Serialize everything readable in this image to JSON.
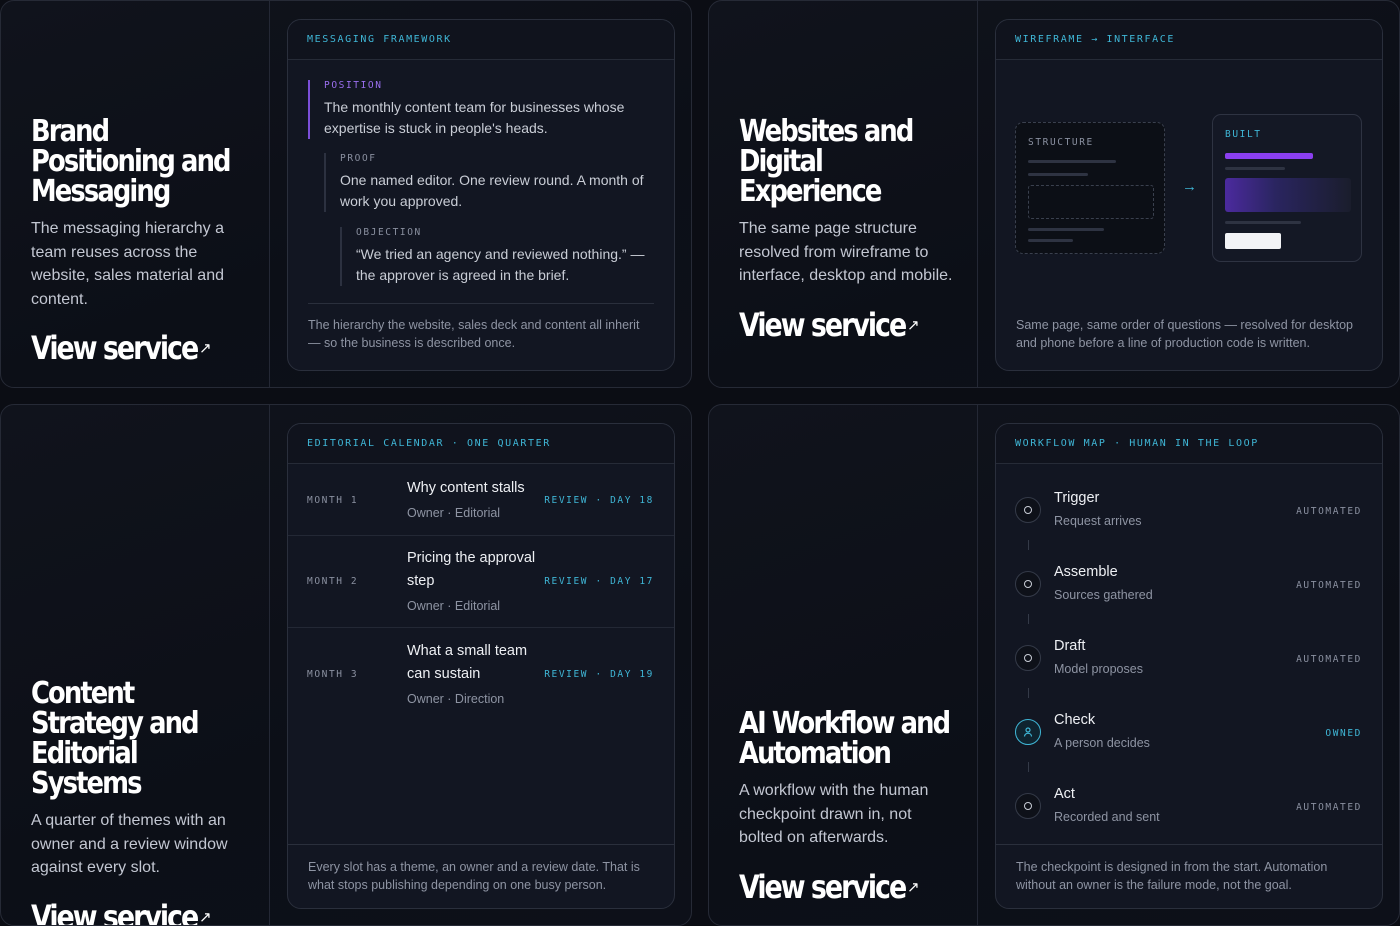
{
  "cards": [
    {
      "title": "Brand Positioning and Messaging",
      "description": "The messaging hierarchy a team reuses across the website, sales material and content.",
      "link": "View service",
      "panel_label": "MESSAGING FRAMEWORK",
      "footnote": "The hierarchy the website, sales deck and content all inherit — so the business is described once."
    },
    {
      "title": "Websites and Digital Experience",
      "description": "The same page structure resolved from wireframe to interface, desktop and mobile.",
      "link": "View service",
      "panel_label": "WIREFRAME → INTERFACE",
      "footnote": "Same page, same order of questions — resolved for desktop and phone before a line of production code is written."
    },
    {
      "title": "Content Strategy and Editorial Systems",
      "description": "A quarter of themes with an owner and a review window against every slot.",
      "link": "View service",
      "panel_label": "EDITORIAL CALENDAR · ONE QUARTER",
      "footnote": "Every slot has a theme, an owner and a review date. That is what stops publishing depending on one busy person."
    },
    {
      "title": "AI Workflow and Automation",
      "description": "A workflow with the human checkpoint drawn in, not bolted on afterwards.",
      "link": "View service",
      "panel_label": "WORKFLOW MAP · HUMAN IN THE LOOP",
      "footnote": "The checkpoint is designed in from the start. Automation without an owner is the failure mode, not the goal."
    }
  ],
  "messaging": [
    {
      "key": "POSITION",
      "value": "The monthly content team for businesses whose expertise is stuck in people's heads."
    },
    {
      "key": "PROOF",
      "value": "One named editor. One review round. A month of work you approved."
    },
    {
      "key": "OBJECTION",
      "value": "“We tried an agency and reviewed nothing.” — the approver is agreed in the brief."
    }
  ],
  "wireframe": {
    "structure_label": "STRUCTURE",
    "built_label": "BUILT"
  },
  "calendar": [
    {
      "month": "MONTH 1",
      "topic": "Why content stalls",
      "owner": "Owner · Editorial",
      "review": "REVIEW · DAY 18"
    },
    {
      "month": "MONTH 2",
      "topic": "Pricing the approval step",
      "owner": "Owner · Editorial",
      "review": "REVIEW · DAY 17"
    },
    {
      "month": "MONTH 3",
      "topic": "What a small team can sustain",
      "owner": "Owner · Direction",
      "review": "REVIEW · DAY 19"
    }
  ],
  "workflow": [
    {
      "step": "Trigger",
      "detail": "Request arrives",
      "status": "AUTOMATED",
      "icon": "circle-icon"
    },
    {
      "step": "Assemble",
      "detail": "Sources gathered",
      "status": "AUTOMATED",
      "icon": "circle-icon"
    },
    {
      "step": "Draft",
      "detail": "Model proposes",
      "status": "AUTOMATED",
      "icon": "circle-icon"
    },
    {
      "step": "Check",
      "detail": "A person decides",
      "status": "OWNED",
      "icon": "person-icon"
    },
    {
      "step": "Act",
      "detail": "Recorded and sent",
      "status": "AUTOMATED",
      "icon": "circle-icon"
    }
  ],
  "colors": {
    "accent": "#3fb6d6",
    "position_accent": "#7b4fd9",
    "built_bar": "#8b3ff0"
  }
}
